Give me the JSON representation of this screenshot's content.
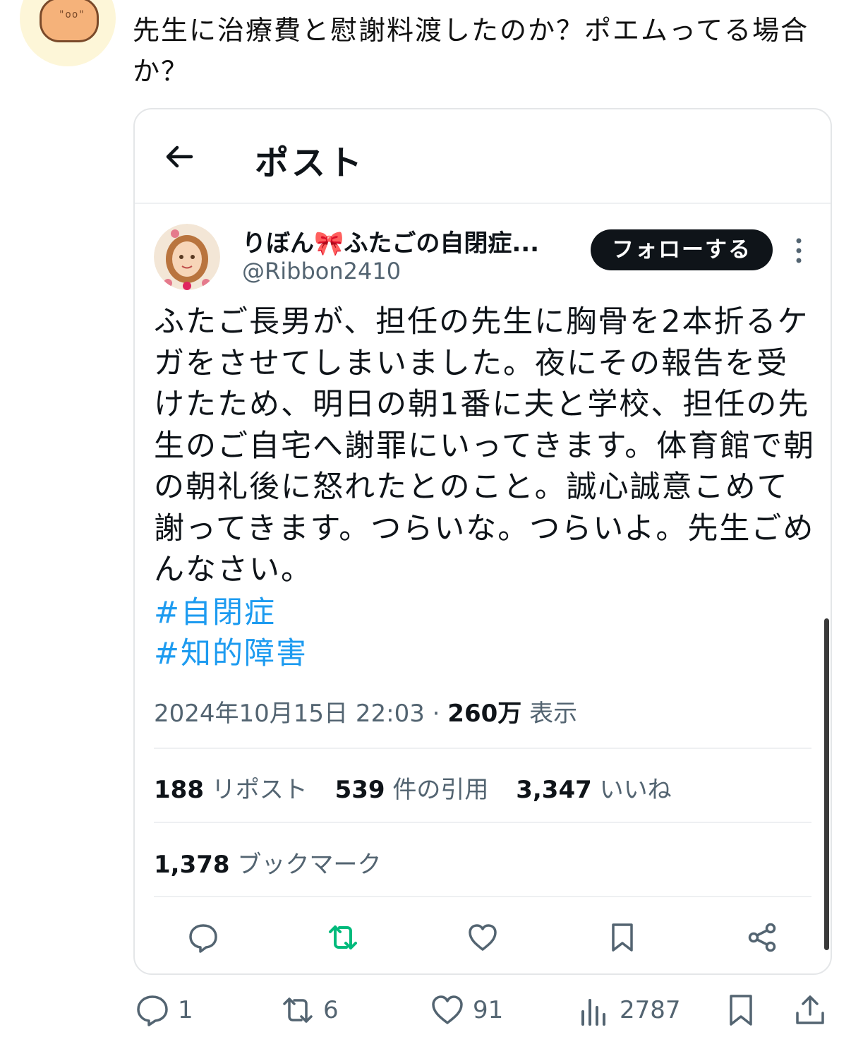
{
  "reply": {
    "avatar_text": "\"oo\"",
    "text": "先生に治療費と慰謝料渡したのか？ポエムってる場合か？"
  },
  "embedded_post": {
    "header_title": "ポスト",
    "author": {
      "name": "りぼん",
      "name_rest": "ふたごの自閉症...",
      "ribbon_emoji": "🎀",
      "handle": "@Ribbon2410"
    },
    "follow_label": "フォローする",
    "body": "ふたご長男が、担任の先生に胸骨を2本折るケガをさせてしまいました。夜にその報告を受けたため、明日の朝1番に夫と学校、担任の先生のご自宅へ謝罪にいってきます。体育館で朝の朝礼後に怒れたとのこと。誠心誠意こめて謝ってきます。つらいな。つらいよ。先生ごめんなさい。",
    "hashtags": [
      "#自閉症",
      "#知的障害"
    ],
    "timestamp": "2024年10月15日 22:03",
    "separator": " · ",
    "views_value": "260万",
    "views_label": "表示",
    "stats": [
      {
        "value": "188",
        "label": "リポスト"
      },
      {
        "value": "539",
        "label": "件の引用"
      },
      {
        "value": "3,347",
        "label": "いいね"
      }
    ],
    "bookmarks": {
      "value": "1,378",
      "label": "ブックマーク"
    }
  },
  "outer_actions": {
    "replies": "1",
    "reposts": "6",
    "likes": "91",
    "views": "2787"
  },
  "colors": {
    "hashtag": "#1d9bf0",
    "repost_green": "#00ba7c",
    "muted": "#536471",
    "button_bg": "#0f1419"
  }
}
